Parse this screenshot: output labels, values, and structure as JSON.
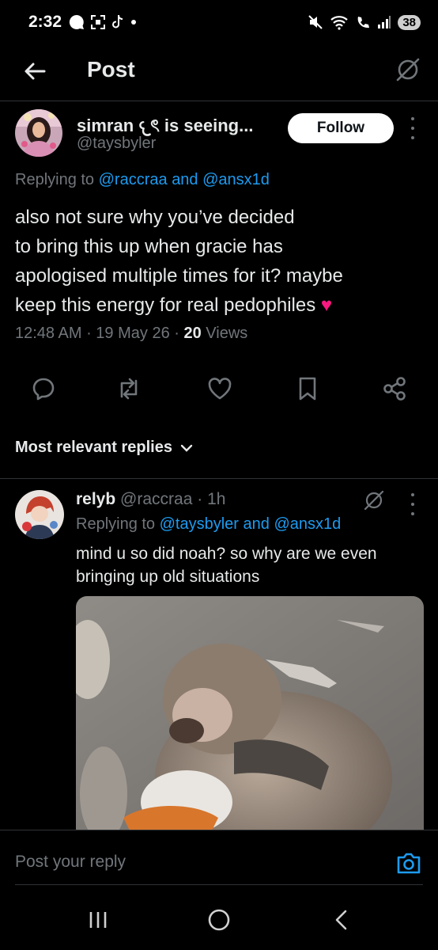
{
  "status_bar": {
    "time": "2:32",
    "battery": "38"
  },
  "header": {
    "title": "Post"
  },
  "post": {
    "author_name": "simran 𐔌ৎ is seeing...",
    "author_handle": "@taysbyler",
    "follow_label": "Follow",
    "replying_prefix": "Replying to",
    "replying_mention_1": "@raccraa",
    "replying_and": "and",
    "replying_mention_2": "@ansx1d",
    "text_lines": [
      "also not sure why you’ve decided",
      "to bring this up when gracie has",
      "apologised multiple times for it? maybe",
      "keep this energy for real pedophiles ♥"
    ],
    "time": "12:48 AM",
    "date": "19 May 26",
    "views_count": "20",
    "views_label": "Views"
  },
  "sort": {
    "label": "Most relevant replies"
  },
  "reply": {
    "name": "relyb",
    "handle": "@raccraa",
    "age": "1h",
    "replying_prefix": "Replying to",
    "replying_mention_1": "@taysbyler",
    "replying_and": "and",
    "replying_mention_2": "@ansx1d",
    "text_lines": [
      "mind u so did noah? so why are we even",
      "bringing up old situations"
    ]
  },
  "compose": {
    "placeholder": "Post your reply"
  },
  "colors": {
    "accent": "#1d9bf0",
    "muted": "#71767b",
    "text": "#e7e9ea",
    "heart": "#f91880"
  }
}
